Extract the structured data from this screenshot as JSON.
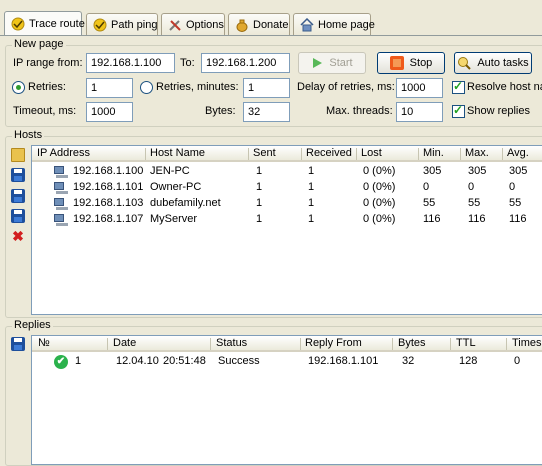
{
  "tabs": [
    {
      "label": "Trace route",
      "icon": "trace-route-icon"
    },
    {
      "label": "Path ping",
      "icon": "path-ping-icon"
    },
    {
      "label": "Options",
      "icon": "tools-icon"
    },
    {
      "label": "Donate",
      "icon": "donate-icon"
    },
    {
      "label": "Home page",
      "icon": "home-icon"
    }
  ],
  "new_page": {
    "title": "New page",
    "ip_range_label": "IP range from:",
    "ip_from": "192.168.1.100",
    "to_label": "To:",
    "ip_to": "192.168.1.200",
    "start_label": "Start",
    "stop_label": "Stop",
    "auto_tasks_label": "Auto tasks",
    "retries_label": "Retries:",
    "retries_value": "1",
    "retries_minutes_label": "Retries, minutes:",
    "retries_minutes_value": "1",
    "delay_label": "Delay of retries, ms:",
    "delay_value": "1000",
    "resolve_label": "Resolve host nam",
    "timeout_label": "Timeout, ms:",
    "timeout_value": "1000",
    "bytes_label": "Bytes:",
    "bytes_value": "32",
    "threads_label": "Max. threads:",
    "threads_value": "10",
    "show_replies_label": "Show replies",
    "retries_selected": true,
    "resolve_checked": true,
    "show_replies_checked": true
  },
  "hosts": {
    "title": "Hosts",
    "columns": [
      "IP Address",
      "Host Name",
      "Sent",
      "Received",
      "Lost",
      "Min.",
      "Max.",
      "Avg."
    ],
    "rows": [
      {
        "ip": "192.168.1.100",
        "host": "JEN-PC",
        "sent": "1",
        "received": "1",
        "lost": "0 (0%)",
        "min": "305",
        "max": "305",
        "avg": "305"
      },
      {
        "ip": "192.168.1.101",
        "host": "Owner-PC",
        "sent": "1",
        "received": "1",
        "lost": "0 (0%)",
        "min": "0",
        "max": "0",
        "avg": "0"
      },
      {
        "ip": "192.168.1.103",
        "host": "dubefamily.net",
        "sent": "1",
        "received": "1",
        "lost": "0 (0%)",
        "min": "55",
        "max": "55",
        "avg": "55"
      },
      {
        "ip": "192.168.1.107",
        "host": "MyServer",
        "sent": "1",
        "received": "1",
        "lost": "0 (0%)",
        "min": "116",
        "max": "116",
        "avg": "116"
      }
    ]
  },
  "replies": {
    "title": "Replies",
    "columns": [
      "№",
      "Date",
      "Status",
      "Reply From",
      "Bytes",
      "TTL",
      "Times ("
    ],
    "rows": [
      {
        "no": "1",
        "date": "12.04.10",
        "time": "20:51:48",
        "status": "Success",
        "from": "192.168.1.101",
        "bytes": "32",
        "ttl": "128",
        "times": "0"
      }
    ]
  }
}
